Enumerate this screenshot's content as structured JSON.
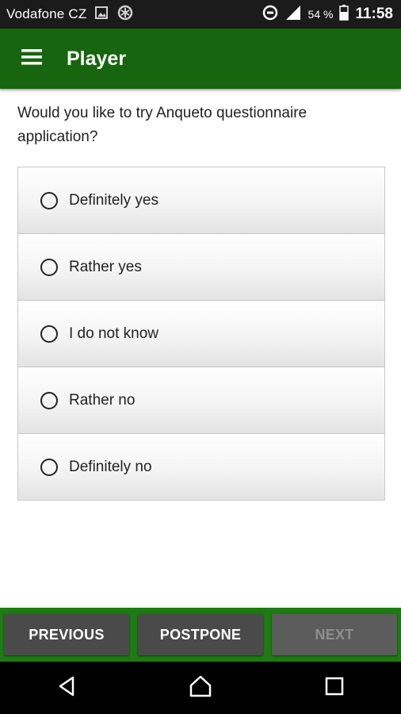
{
  "status_bar": {
    "carrier": "Vodafone CZ",
    "battery_percent": "54 %",
    "time": "11:58",
    "icons": [
      "image-icon",
      "data-saver-icon",
      "do-not-disturb-icon",
      "signal-icon",
      "battery-icon"
    ]
  },
  "app_bar": {
    "title": "Player",
    "menu_icon": "hamburger-menu-icon"
  },
  "question": {
    "text": "Would you like to try Anqueto questionnaire application?"
  },
  "options": [
    {
      "label": "Definitely yes",
      "selected": false
    },
    {
      "label": "Rather yes",
      "selected": false
    },
    {
      "label": "I do not know",
      "selected": false
    },
    {
      "label": "Rather no",
      "selected": false
    },
    {
      "label": "Definitely no",
      "selected": false
    }
  ],
  "buttons": {
    "previous": "PREVIOUS",
    "postpone": "POSTPONE",
    "next": "NEXT",
    "next_enabled": false
  },
  "system_nav": {
    "icons": [
      "back-icon",
      "home-icon",
      "recents-icon"
    ]
  },
  "colors": {
    "app_bar": "#17650f",
    "button_bar": "#1e7b13",
    "button": "#4a4a4a",
    "status_bar": "#1b1b1b"
  }
}
